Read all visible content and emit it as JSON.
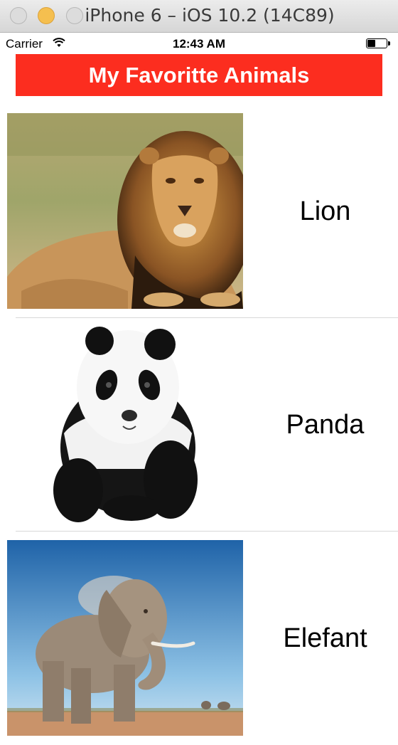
{
  "window": {
    "title": "iPhone 6 – iOS 10.2 (14C89)"
  },
  "status_bar": {
    "carrier": "Carrier",
    "time": "12:43 AM",
    "battery_level": 0.4
  },
  "header": {
    "title": "My Favoritte Animals"
  },
  "animals": [
    {
      "name": "Lion"
    },
    {
      "name": "Panda"
    },
    {
      "name": "Elefant"
    }
  ]
}
